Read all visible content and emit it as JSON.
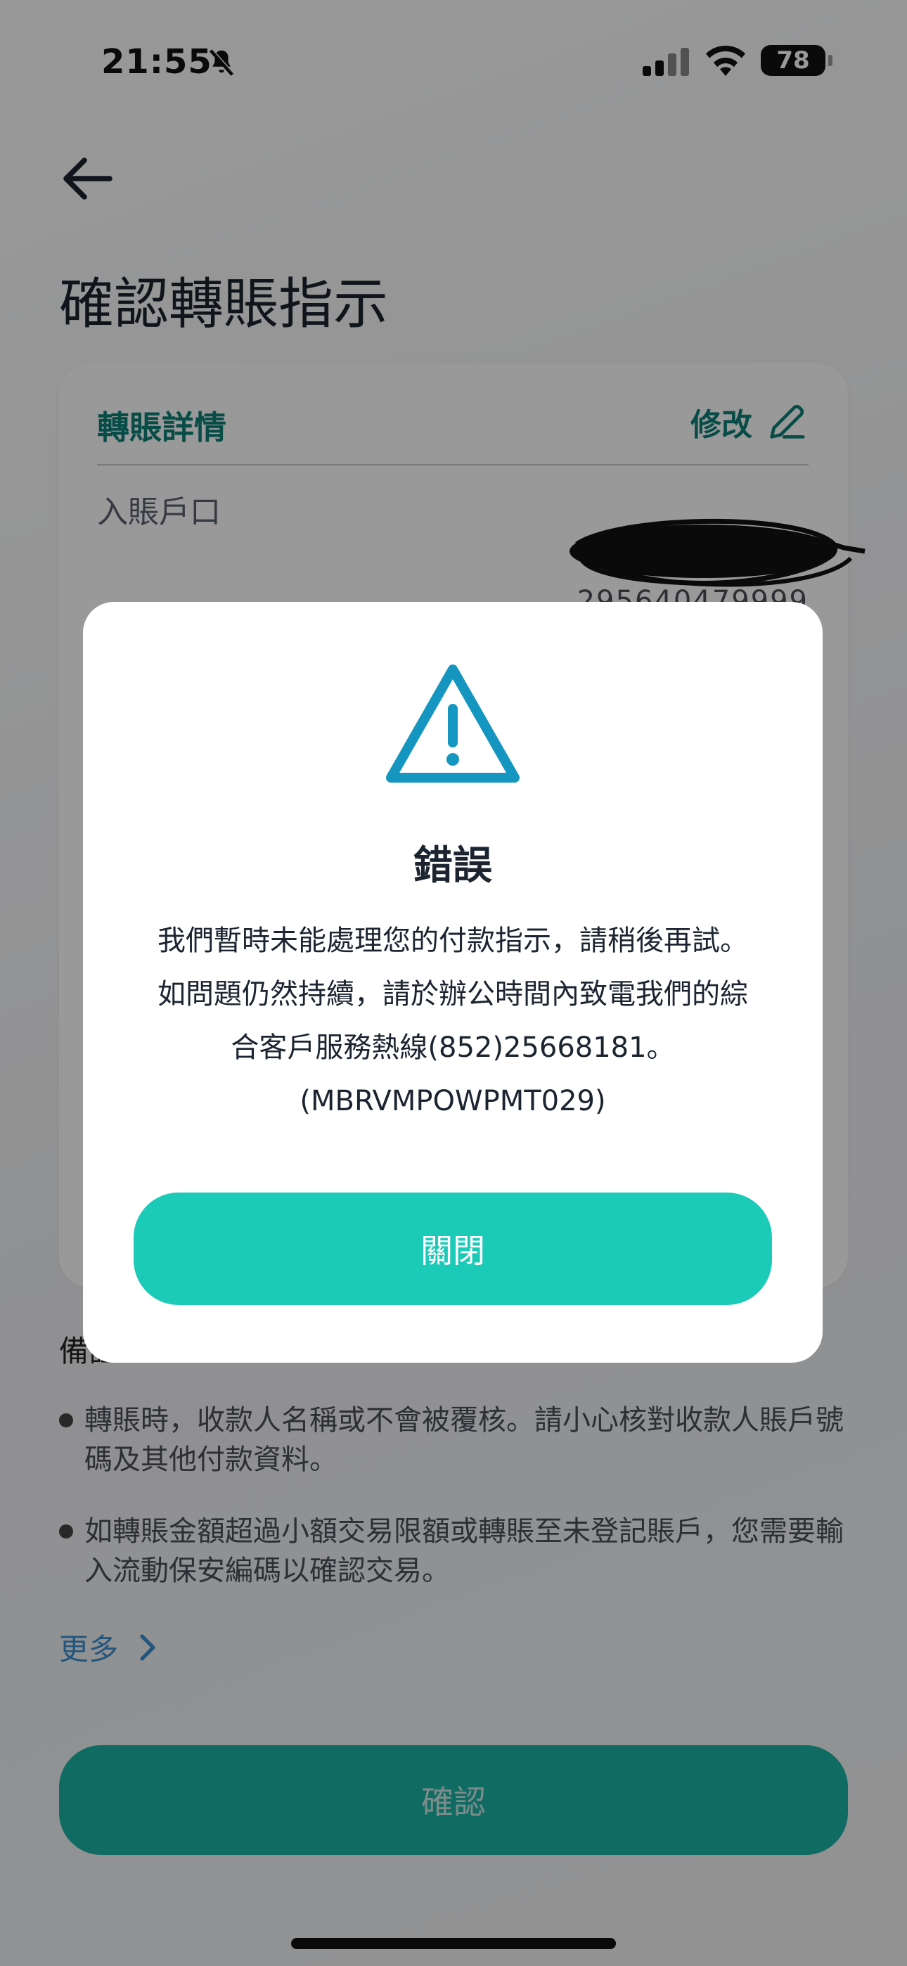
{
  "status_bar": {
    "time": "21:55",
    "battery": "78",
    "icons": [
      "bell-slash-icon",
      "cellular-signal-icon",
      "wifi-icon",
      "battery-icon"
    ]
  },
  "header": {
    "title": "確認轉賬指示"
  },
  "details_card": {
    "title": "轉賬詳情",
    "edit_label": "修改",
    "payee_account_label": "入賬戶口",
    "payee_account_number": "295640479999"
  },
  "notes": {
    "title": "備註",
    "items": [
      "轉賬時，收款人名稱或不會被覆核。請小心核對收款人賬戶號碼及其他付款資料。",
      "如轉賬金額超過小額交易限額或轉賬至未登記賬戶，您需要輸入流動保安編碼以確認交易。"
    ],
    "more_label": "更多"
  },
  "confirm_label": "確認",
  "dialog": {
    "title": "錯誤",
    "message_lines": [
      "我們暫時未能處理您的付款指示，請稍後再試。",
      "如問題仍然持續，請於辦公時間內致電我們的綜",
      "合客戶服務熱線(852)25668181。",
      "(MBRVMPOWPMT029)"
    ],
    "close_label": "關閉"
  },
  "colors": {
    "accent_teal": "#1ccab8",
    "dark_teal": "#0e7f78",
    "warning_blue": "#1596c0",
    "link_blue": "#3b8fd0"
  }
}
